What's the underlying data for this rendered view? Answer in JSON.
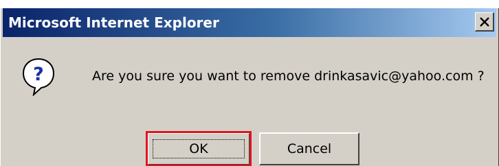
{
  "window": {
    "title": "Microsoft Internet Explorer",
    "close_icon": "close-x"
  },
  "dialog": {
    "icon": "question-icon",
    "message": "Are you sure you want to remove drinkasavic@yahoo.com ?"
  },
  "buttons": {
    "ok_label": "OK",
    "cancel_label": "Cancel"
  },
  "colors": {
    "titlebar_start": "#0a246a",
    "titlebar_end": "#a6caf0",
    "dialog_bg": "#d4d0c8",
    "highlight": "#e0141e"
  }
}
